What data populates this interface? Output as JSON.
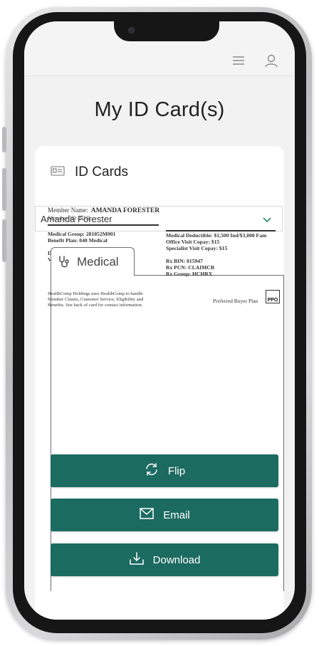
{
  "header": {
    "menu_icon": "hamburger-menu-icon",
    "account_icon": "user-account-icon"
  },
  "page": {
    "title": "My ID Card(s)"
  },
  "id_cards": {
    "section_title": "ID Cards",
    "section_icon": "id-card-icon",
    "member_select": {
      "value": "Amanda Forester",
      "icon": "chevron-down-icon"
    },
    "tabs": [
      {
        "label": "Medical",
        "icon": "stethoscope-icon"
      }
    ]
  },
  "card": {
    "member_name_label": "Member Name:",
    "member_name_value": "AMANDA FORESTER",
    "member_id": "Member ID: NHL",
    "left_lines": [
      "Medical Group: 281052M001",
      "Benefit Plan: 040 Medical",
      "",
      "Dental Group: 281658001",
      "Vision: Contact HealthComp"
    ],
    "right_lines": [
      "Medical Deductible: $1,500 Ind/$3,000 Fam",
      "Office Visit Copay: $15",
      "Specialist Visit Copay: $15",
      "",
      "Rx BIN: 015947",
      "Rx PCN: CLAIMCR",
      "Rx Group: HCHRX"
    ],
    "footnote": "HealthComp Holdings uses HealthComp to handle Member Claims, Customer Service, Eligibility and Benefits. See back of card for contact information.",
    "plan_label": "Preferred Buyer Plan",
    "network_badge": "PPO"
  },
  "actions": {
    "flip": {
      "label": "Flip",
      "icon": "refresh-icon"
    },
    "email": {
      "label": "Email",
      "icon": "envelope-icon"
    },
    "download": {
      "label": "Download",
      "icon": "download-icon"
    }
  },
  "colors": {
    "primary": "#1c6b60",
    "accent_chevron": "#2a8a6a",
    "screen_bg": "#f2f2f3"
  }
}
